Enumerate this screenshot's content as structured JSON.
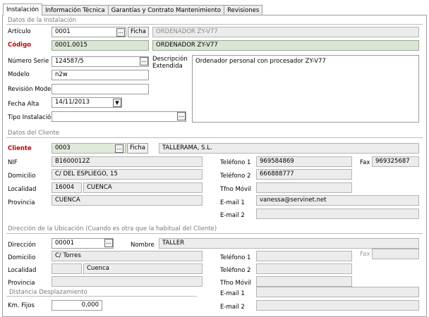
{
  "tabs": [
    "Instalación",
    "Información Técnica",
    "Garantías y Contrato Mantenimiento",
    "Revisiones"
  ],
  "sections": {
    "installation": "Datos de la Instalación",
    "client": "Datos del Cliente",
    "location": "Dirección de la Ubicación (Cuando es otra que la habitual del Cliente)",
    "distance": "Distancia Desplazamiento"
  },
  "install": {
    "articulo_label": "Artículo",
    "articulo_value": "0001",
    "articulo_desc": "ORDENADOR ZY-V77",
    "ficha_label": "Ficha",
    "codigo_label": "Código",
    "codigo_value": "0001.0015",
    "codigo_desc": "ORDENADOR ZY-V77",
    "serie_label": "Número Serie",
    "serie_value": "124587/5",
    "desc_ext_label_1": "Descripción",
    "desc_ext_label_2": "Extendida",
    "desc_ext_value": "Ordenador personal con procesador ZY-V77",
    "modelo_label": "Modelo",
    "modelo_value": "n2w",
    "revision_label": "Revisión Modelo",
    "revision_value": "",
    "fecha_label": "Fecha Alta",
    "fecha_value": "14/11/2013",
    "tipo_label": "Tipo Instalación",
    "tipo_value": ""
  },
  "client": {
    "cliente_label": "Cliente",
    "cliente_value": "0003",
    "ficha_label": "Ficha",
    "cliente_name": "TALLERAMA, S.L.",
    "nif_label": "NIF",
    "nif_value": "B1600012Z",
    "domicilio_label": "Domicilio",
    "domicilio_value": "C/ DEL ESPLIEGO, 15",
    "localidad_label": "Localidad",
    "cp_value": "16004",
    "localidad_value": "CUENCA",
    "provincia_label": "Provincia",
    "provincia_value": "CUENCA",
    "tel1_label": "Teléfono 1",
    "tel1_value": "969584869",
    "fax_label": "Fax",
    "fax_value": "969325687",
    "tel2_label": "Teléfono 2",
    "tel2_value": "666888777",
    "movil_label": "Tfno Móvil",
    "movil_value": "",
    "email1_label": "E-mail 1",
    "email1_value": "vanessa@servinet.net",
    "email2_label": "E-mail 2",
    "email2_value": ""
  },
  "location": {
    "direccion_label": "Dirección",
    "direccion_value": "00001",
    "nombre_label": "Nombre",
    "nombre_value": "TALLER",
    "domicilio_label": "Domicilio",
    "domicilio_value": "C/ Torres",
    "localidad_label": "Localidad",
    "cp_value": "",
    "localidad_value": "Cuenca",
    "provincia_label": "Provincia",
    "provincia_value": "",
    "tel1_label": "Teléfono 1",
    "tel1_value": "",
    "fax_label": "Fax",
    "fax_value": "",
    "tel2_label": "Teléfono 2",
    "tel2_value": "",
    "movil_label": "Tfno Móvil",
    "movil_value": "",
    "email1_label": "E-mail 1",
    "email1_value": "",
    "email2_label": "E-mail 2",
    "email2_value": ""
  },
  "distance": {
    "km_label": "Km. Fijos",
    "km_value": "0,000"
  },
  "glyphs": {
    "ellipsis": "...",
    "dropdown": "▼"
  }
}
